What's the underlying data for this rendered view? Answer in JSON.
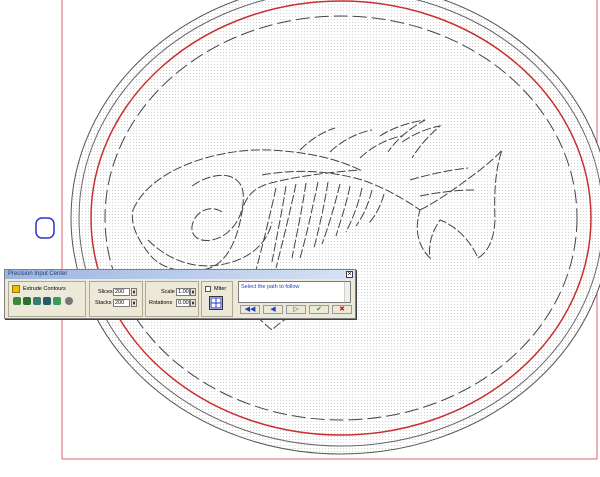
{
  "dialog": {
    "title": "Precision Input Center",
    "close_glyph": "×",
    "mode_label": "Extrude Contours",
    "slices_label": "Slices",
    "slices_value": "200",
    "stacks_label": "Stacks",
    "stacks_value": "200",
    "scale_label": "Scale",
    "scale_value": "1.00",
    "rotations_label": "Rotations",
    "rotations_value": "0.00",
    "miter_label": "Miter",
    "miter_checked": false,
    "status_text": "Select the path to follow",
    "buttons": {
      "first": "◀◀",
      "prev": "◀",
      "next": "▷",
      "ok": "✔",
      "cancel": "✖"
    }
  },
  "tools": [
    "extrude-icon",
    "shape1-icon",
    "shape2-icon",
    "shape3-icon",
    "shape4-icon",
    "sphere-icon"
  ],
  "colors": {
    "border_red": "#e06070",
    "path_red": "#c83030",
    "outline": "#555555",
    "dialog_bg": "#ece9d8",
    "status_text": "#1f3ec8"
  }
}
